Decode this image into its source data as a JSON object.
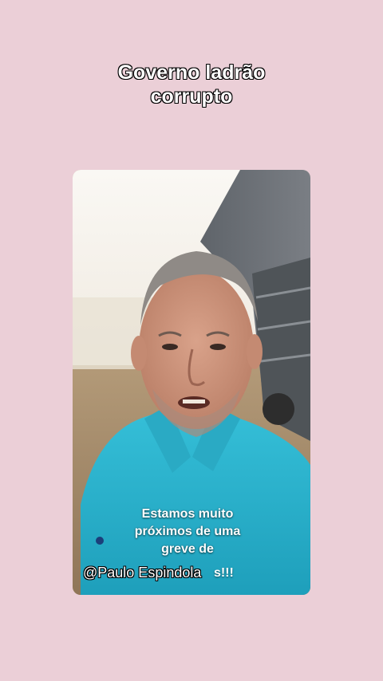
{
  "title": {
    "line1": "Governo ladrão",
    "line2": "corrupto"
  },
  "video": {
    "caption_lines": [
      "Estamos muito",
      "próximos de uma",
      "greve de"
    ],
    "caption_tail": "s!!!",
    "watermark": "@Paulo Espindola"
  },
  "colors": {
    "background": "#ebcfd7",
    "shirt": "#2bb3cc",
    "sky": "#f6f3ee",
    "ground": "#a18564"
  }
}
